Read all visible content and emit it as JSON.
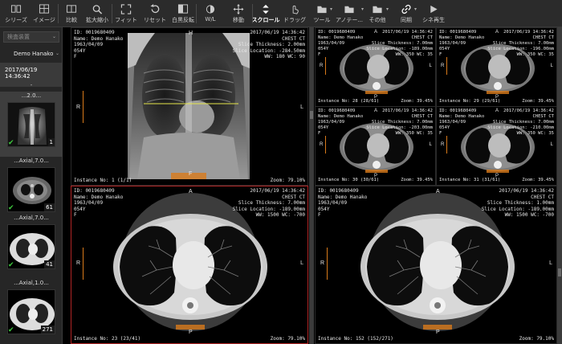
{
  "toolbar": {
    "items": [
      {
        "label": "シリーズ",
        "icon": "series-icon"
      },
      {
        "label": "イメージ",
        "icon": "image-icon"
      },
      {
        "label": "比較",
        "icon": "compare-icon"
      },
      {
        "label": "拡大縮小",
        "icon": "zoom-icon"
      },
      {
        "label": "フィット",
        "icon": "fit-icon"
      },
      {
        "label": "リセット",
        "icon": "reset-icon"
      },
      {
        "label": "白黒反転",
        "icon": "invert-icon"
      },
      {
        "label": "W/L",
        "icon": "window-level-icon"
      },
      {
        "label": "移動",
        "icon": "pan-icon"
      },
      {
        "label": "スクロール",
        "icon": "scroll-icon"
      },
      {
        "label": "ドラッグ",
        "icon": "drag-icon"
      },
      {
        "label": "ツール",
        "icon": "tool-icon"
      },
      {
        "label": "アノテー...",
        "icon": "annotation-icon"
      },
      {
        "label": "その他",
        "icon": "other-icon"
      },
      {
        "label": "同期",
        "icon": "sync-icon"
      },
      {
        "label": "シネ再生",
        "icon": "cine-play-icon"
      }
    ]
  },
  "sidebar": {
    "search_placeholder": "検査装置",
    "patient_name": "Demo Hanako",
    "study_datetime": "2017/06/19 14:36:42",
    "study_sub": "-",
    "series": [
      {
        "name": "...2.0...",
        "count": "1"
      },
      {
        "name": "...Axial,7.0...",
        "count": "61"
      },
      {
        "name": "...Axial,7.0...",
        "count": "41"
      },
      {
        "name": "...Axial,1.0...",
        "count": "271"
      }
    ]
  },
  "viewports": {
    "scout": {
      "top_left": "ID: 0019680409\nName: Demo Hanako\n1963/04/09\n054Y\nF",
      "top_right": "2017/06/19 14:36:42\nCHEST CT\nSlice Thickness: 2.00mm\nSlice Location: -284.50mm\nWW: 180 WC: 90",
      "bottom_left": "Instance No: 1 (1/1)",
      "bottom_right": "Zoom: 79.10%",
      "ori_top": "H",
      "ori_left": "R",
      "ori_right": "L",
      "ori_bottom": "F"
    },
    "small": [
      {
        "top_right": "2017/06/19 14:36:42\nCHEST CT\nSlice Thickness: 7.00mm\nSlice Location: -189.00mm\nWW: 350 WC: 35",
        "instance": "Instance No: 28 (28/61)",
        "zoom": "Zoom: 39.45%"
      },
      {
        "top_right": "2017/06/19 14:36:42\nCHEST CT\nSlice Thickness: 7.00mm\nSlice Location: -196.00mm\nWW: 350 WC: 35",
        "instance": "Instance No: 29 (29/61)",
        "zoom": "Zoom: 39.45%"
      },
      {
        "top_right": "2017/06/19 14:36:42\nCHEST CT\nSlice Thickness: 7.00mm\nSlice Location: -203.00mm\nWW: 350 WC: 35",
        "instance": "Instance No: 30 (30/61)",
        "zoom": "Zoom: 39.45%"
      },
      {
        "top_right": "2017/06/19 14:36:42\nCHEST CT\nSlice Thickness: 7.00mm\nSlice Location: -210.00mm\nWW: 350 WC: 35",
        "instance": "Instance No: 31 (31/61)",
        "zoom": "Zoom: 39.45%"
      }
    ],
    "small_top_left": "ID: 0019680409\nName: Demo Hanako\n1963/04/09\n054Y\nF",
    "small_ori": {
      "top": "A",
      "left": "R",
      "right": "L",
      "bottom": "P"
    },
    "lung_left": {
      "top_left": "ID: 0019680409\nName: Demo Hanako\n1963/04/09\n054Y\nF",
      "top_right": "2017/06/19 14:36:42\nCHEST CT\nSlice Thickness: 7.00mm\nSlice Location: -189.00mm\nWW: 1500 WC: -700",
      "bottom_left": "Instance No: 23 (23/41)",
      "bottom_right": "Zoom: 79.10%",
      "ori_top": "A",
      "ori_left": "R",
      "ori_right": "L",
      "ori_bottom": "P"
    },
    "lung_right": {
      "top_left": "ID: 0019680409\nName: Demo Hanako\n1963/04/09\n054Y\nF",
      "top_right": "2017/06/19 14:36:42\nCHEST CT\nSlice Thickness: 1.00mm\nSlice Location: -189.00mm\nWW: 1500 WC: -700",
      "bottom_left": "Instance No: 152 (152/271)",
      "bottom_right": "Zoom: 79.10%",
      "ori_top": "A",
      "ori_left": "R",
      "ori_right": "L",
      "ori_bottom": "P"
    }
  },
  "colors": {
    "accent_active": "#b02525",
    "ruler": "#d97a1a",
    "check": "#3ec83e",
    "scout_line": "#e6e64a"
  }
}
